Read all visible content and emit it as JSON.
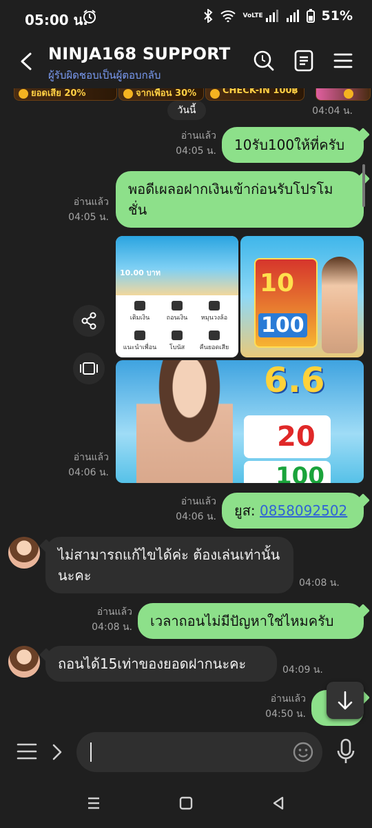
{
  "status_bar": {
    "time": "05:00 น.",
    "battery": "51%",
    "network": "VoLTE"
  },
  "header": {
    "title": "NINJA168 SUPPORT",
    "subtitle": "ผู้รับผิดชอบเป็นผู้ตอบกลับ"
  },
  "banners": [
    "ยอดเสีย 20%",
    "จากเพื่อน 30%",
    "CHECK-IN 100฿"
  ],
  "date_separator": "วันนี้",
  "messages": [
    {
      "time": "04:04 น."
    },
    {
      "read": "อ่านแล้ว",
      "time": "04:05 น.",
      "text": "10รับ100ให้ที่ครับ"
    },
    {
      "read": "อ่านแล้ว",
      "time": "04:05 น.",
      "text": "พอดีเผลอฝากเงินเข้าก่อนรับโปรโมชั่น"
    },
    {
      "read": "อ่านแล้ว",
      "time": "04:06 น."
    },
    {
      "read": "อ่านแล้ว",
      "time": "04:06 น.",
      "prefix": "ยูส: ",
      "link": "0858092502"
    },
    {
      "time": "04:08 น.",
      "text": "ไม่สามารถแก้ไขได้ค่ะ ต้องเล่นเท่านั้นนะคะ"
    },
    {
      "read": "อ่านแล้ว",
      "time": "04:08 น.",
      "text": "เวลาถอนไม่มีปัญหาใช่ไหมครับ"
    },
    {
      "time": "04:09 น.",
      "text": "ถอนได้15เท่าของยอดฝากนะคะ"
    },
    {
      "read": "อ่านแล้ว",
      "time": "04:50 น."
    }
  ],
  "images": {
    "a": {
      "amount": "10.00 บาท",
      "items": [
        "เติมเงิน",
        "ถอนเงิน",
        "หมุนวงล้อ",
        "แนะนำเพื่อน",
        "โบนัส",
        "คืนยอดเสีย"
      ]
    },
    "b": {
      "num1": "10",
      "num2": "100"
    },
    "c": {
      "promo": "6.6",
      "num1": "20",
      "num2": "100"
    }
  },
  "icons": [
    "back-arrow",
    "search",
    "notes",
    "menu",
    "share",
    "gallery",
    "scroll-down",
    "emoji",
    "mic"
  ],
  "colors": {
    "outgoing": "#8de08a",
    "incoming": "#2e2e2e",
    "link": "#2f63d6",
    "subtitle": "#7a9bf2"
  },
  "input": {
    "placeholder": ""
  }
}
